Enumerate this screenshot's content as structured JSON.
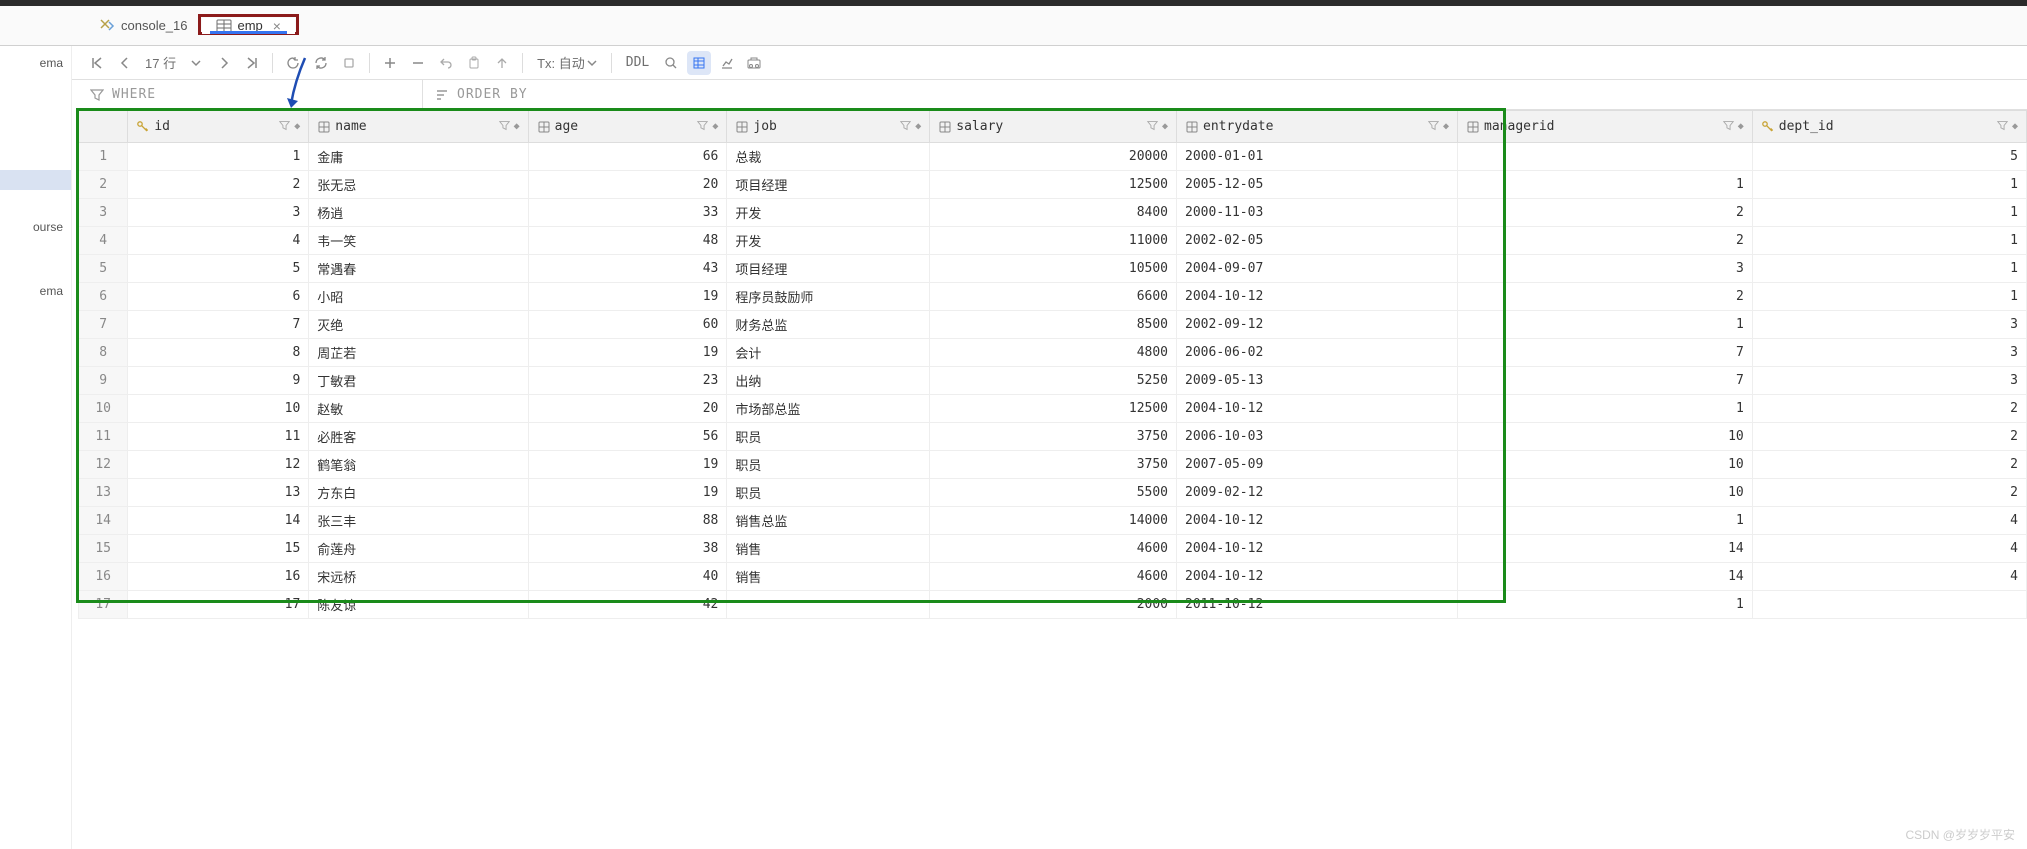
{
  "tabs": [
    {
      "label": "console_16",
      "icon": "query-icon",
      "active": false
    },
    {
      "label": "emp",
      "icon": "table-icon",
      "active": true
    }
  ],
  "toolbar": {
    "rows_label": "17 行",
    "tx": "Tx: 自动",
    "ddl": "DDL"
  },
  "filter": {
    "where": "WHERE",
    "orderby": "ORDER BY"
  },
  "left_panel": [
    "ema",
    "",
    "ourse",
    "ema"
  ],
  "columns": [
    {
      "name": "id",
      "key": true,
      "align": "num"
    },
    {
      "name": "name",
      "key": false,
      "align": "txt"
    },
    {
      "name": "age",
      "key": false,
      "align": "num"
    },
    {
      "name": "job",
      "key": false,
      "align": "txt"
    },
    {
      "name": "salary",
      "key": false,
      "align": "num"
    },
    {
      "name": "entrydate",
      "key": false,
      "align": "txt"
    },
    {
      "name": "managerid",
      "key": false,
      "align": "num"
    },
    {
      "name": "dept_id",
      "key": true,
      "align": "num"
    }
  ],
  "rows": [
    {
      "id": 1,
      "name": "金庸",
      "age": 66,
      "job": "总裁",
      "salary": 20000,
      "entrydate": "2000-01-01",
      "managerid": null,
      "dept_id": 5
    },
    {
      "id": 2,
      "name": "张无忌",
      "age": 20,
      "job": "项目经理",
      "salary": 12500,
      "entrydate": "2005-12-05",
      "managerid": 1,
      "dept_id": 1
    },
    {
      "id": 3,
      "name": "杨逍",
      "age": 33,
      "job": "开发",
      "salary": 8400,
      "entrydate": "2000-11-03",
      "managerid": 2,
      "dept_id": 1
    },
    {
      "id": 4,
      "name": "韦一笑",
      "age": 48,
      "job": "开发",
      "salary": 11000,
      "entrydate": "2002-02-05",
      "managerid": 2,
      "dept_id": 1
    },
    {
      "id": 5,
      "name": "常遇春",
      "age": 43,
      "job": "项目经理",
      "salary": 10500,
      "entrydate": "2004-09-07",
      "managerid": 3,
      "dept_id": 1
    },
    {
      "id": 6,
      "name": "小昭",
      "age": 19,
      "job": "程序员鼓励师",
      "salary": 6600,
      "entrydate": "2004-10-12",
      "managerid": 2,
      "dept_id": 1
    },
    {
      "id": 7,
      "name": "灭绝",
      "age": 60,
      "job": "财务总监",
      "salary": 8500,
      "entrydate": "2002-09-12",
      "managerid": 1,
      "dept_id": 3
    },
    {
      "id": 8,
      "name": "周芷若",
      "age": 19,
      "job": "会计",
      "salary": 4800,
      "entrydate": "2006-06-02",
      "managerid": 7,
      "dept_id": 3
    },
    {
      "id": 9,
      "name": "丁敏君",
      "age": 23,
      "job": "出纳",
      "salary": 5250,
      "entrydate": "2009-05-13",
      "managerid": 7,
      "dept_id": 3
    },
    {
      "id": 10,
      "name": "赵敏",
      "age": 20,
      "job": "市场部总监",
      "salary": 12500,
      "entrydate": "2004-10-12",
      "managerid": 1,
      "dept_id": 2
    },
    {
      "id": 11,
      "name": "必胜客",
      "age": 56,
      "job": "职员",
      "salary": 3750,
      "entrydate": "2006-10-03",
      "managerid": 10,
      "dept_id": 2
    },
    {
      "id": 12,
      "name": "鹤笔翁",
      "age": 19,
      "job": "职员",
      "salary": 3750,
      "entrydate": "2007-05-09",
      "managerid": 10,
      "dept_id": 2
    },
    {
      "id": 13,
      "name": "方东白",
      "age": 19,
      "job": "职员",
      "salary": 5500,
      "entrydate": "2009-02-12",
      "managerid": 10,
      "dept_id": 2
    },
    {
      "id": 14,
      "name": "张三丰",
      "age": 88,
      "job": "销售总监",
      "salary": 14000,
      "entrydate": "2004-10-12",
      "managerid": 1,
      "dept_id": 4
    },
    {
      "id": 15,
      "name": "俞莲舟",
      "age": 38,
      "job": "销售",
      "salary": 4600,
      "entrydate": "2004-10-12",
      "managerid": 14,
      "dept_id": 4
    },
    {
      "id": 16,
      "name": "宋远桥",
      "age": 40,
      "job": "销售",
      "salary": 4600,
      "entrydate": "2004-10-12",
      "managerid": 14,
      "dept_id": 4
    },
    {
      "id": 17,
      "name": "陈友谅",
      "age": 42,
      "job": null,
      "salary": 2000,
      "entrydate": "2011-10-12",
      "managerid": 1,
      "dept_id": null
    }
  ],
  "null_display": "<null>",
  "watermark": "CSDN @岁岁岁平安"
}
